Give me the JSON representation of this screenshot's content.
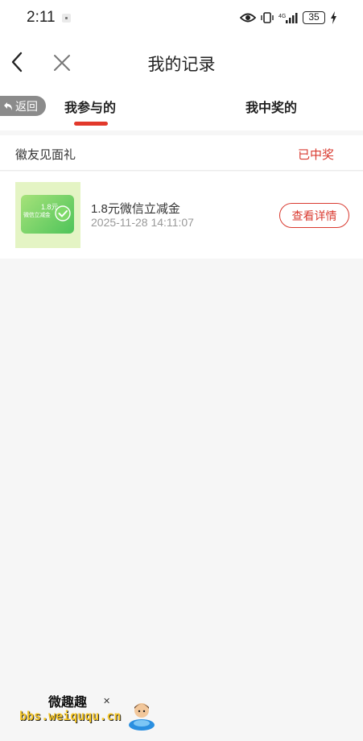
{
  "status_bar": {
    "time": "2:11",
    "network": "4G",
    "battery": "35",
    "icons": [
      "eye-icon",
      "vibrate-icon",
      "signal-icon",
      "battery-icon",
      "bolt-icon"
    ]
  },
  "header": {
    "title": "我的记录",
    "icons": [
      "back-icon",
      "close-icon"
    ]
  },
  "return_pill": {
    "label": "返回"
  },
  "tabs": [
    {
      "label": "我参与的",
      "active": true
    },
    {
      "label": "我中奖的",
      "active": false
    }
  ],
  "section": {
    "title": "徽友见面礼",
    "status": "已中奖"
  },
  "records": [
    {
      "name": "1.8元微信立减金",
      "time": "2025-11-28 14:11:07",
      "action": "查看详情",
      "thumb_amount": "1.8元",
      "thumb_caption": "微信立减金"
    }
  ],
  "watermark": {
    "title": "微趣趣",
    "url": "bbs.weiququ.cn"
  },
  "colors": {
    "accent": "#d93a30",
    "indicator": "#e2392b",
    "background": "#f6f6f6"
  }
}
